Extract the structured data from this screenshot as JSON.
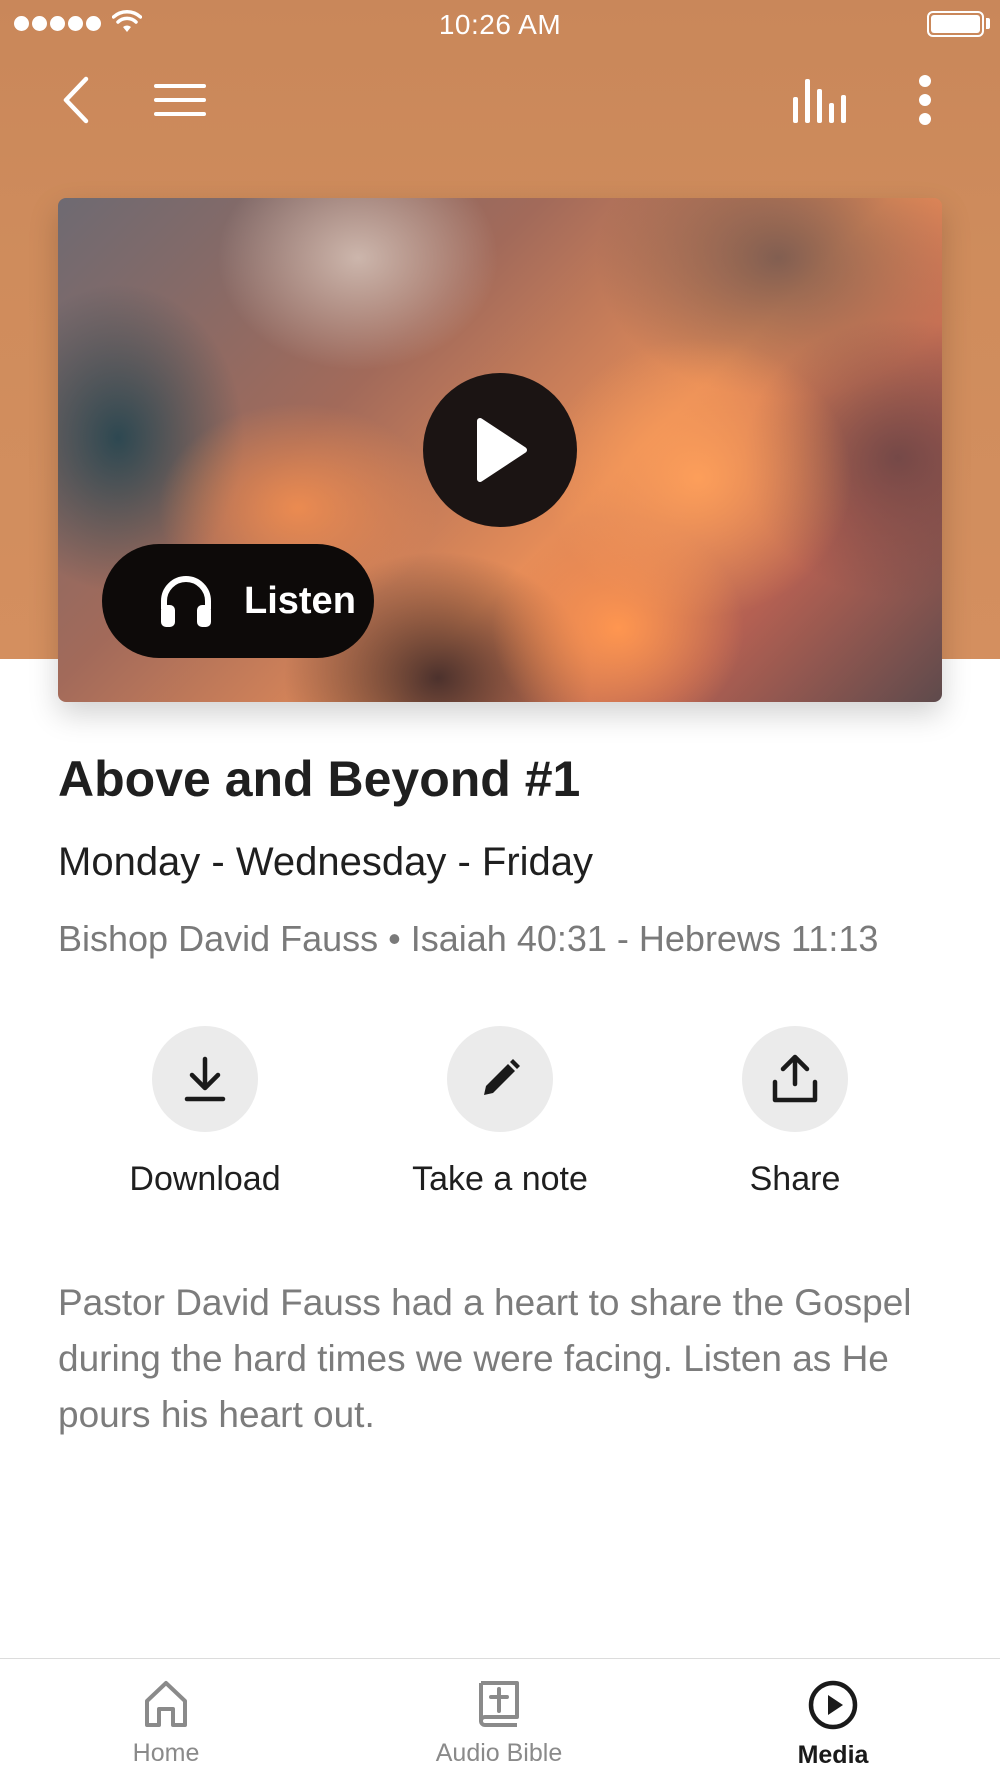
{
  "status_bar": {
    "time": "10:26 AM",
    "signal_bars": 5,
    "battery_level": 1.0
  },
  "colors": {
    "header_accent": "#cd8a5c",
    "play_button": "#1b1413",
    "listen_button": "#0d0a09",
    "active_tab": "#1a1a1a",
    "inactive_tab": "#8a8a8a"
  },
  "nav": {
    "back_icon": "chevron-left-icon",
    "menu_icon": "hamburger-menu-icon",
    "audio_icon": "equalizer-bars-icon",
    "more_icon": "vertical-dots-icon"
  },
  "media": {
    "image": "sunset-clouds",
    "play_icon": "play-icon",
    "listen_label": "Listen",
    "listen_icon": "headphones-icon"
  },
  "episode": {
    "title": "Above and Beyond #1",
    "schedule": "Monday - Wednesday - Friday",
    "meta": "Bishop David Fauss • Isaiah 40:31 - Hebrews 11:13",
    "description": "Pastor David Fauss had a heart to share the Gospel during the hard times we were facing. Listen as He pours his heart out."
  },
  "actions": [
    {
      "label": "Download",
      "icon": "download-icon"
    },
    {
      "label": "Take a note",
      "icon": "pencil-icon"
    },
    {
      "label": "Share",
      "icon": "share-upload-icon"
    }
  ],
  "tabs": [
    {
      "label": "Home",
      "icon": "home-icon",
      "active": false
    },
    {
      "label": "Audio Bible",
      "icon": "bible-icon",
      "active": false
    },
    {
      "label": "Media",
      "icon": "play-circle-icon",
      "active": true
    }
  ]
}
